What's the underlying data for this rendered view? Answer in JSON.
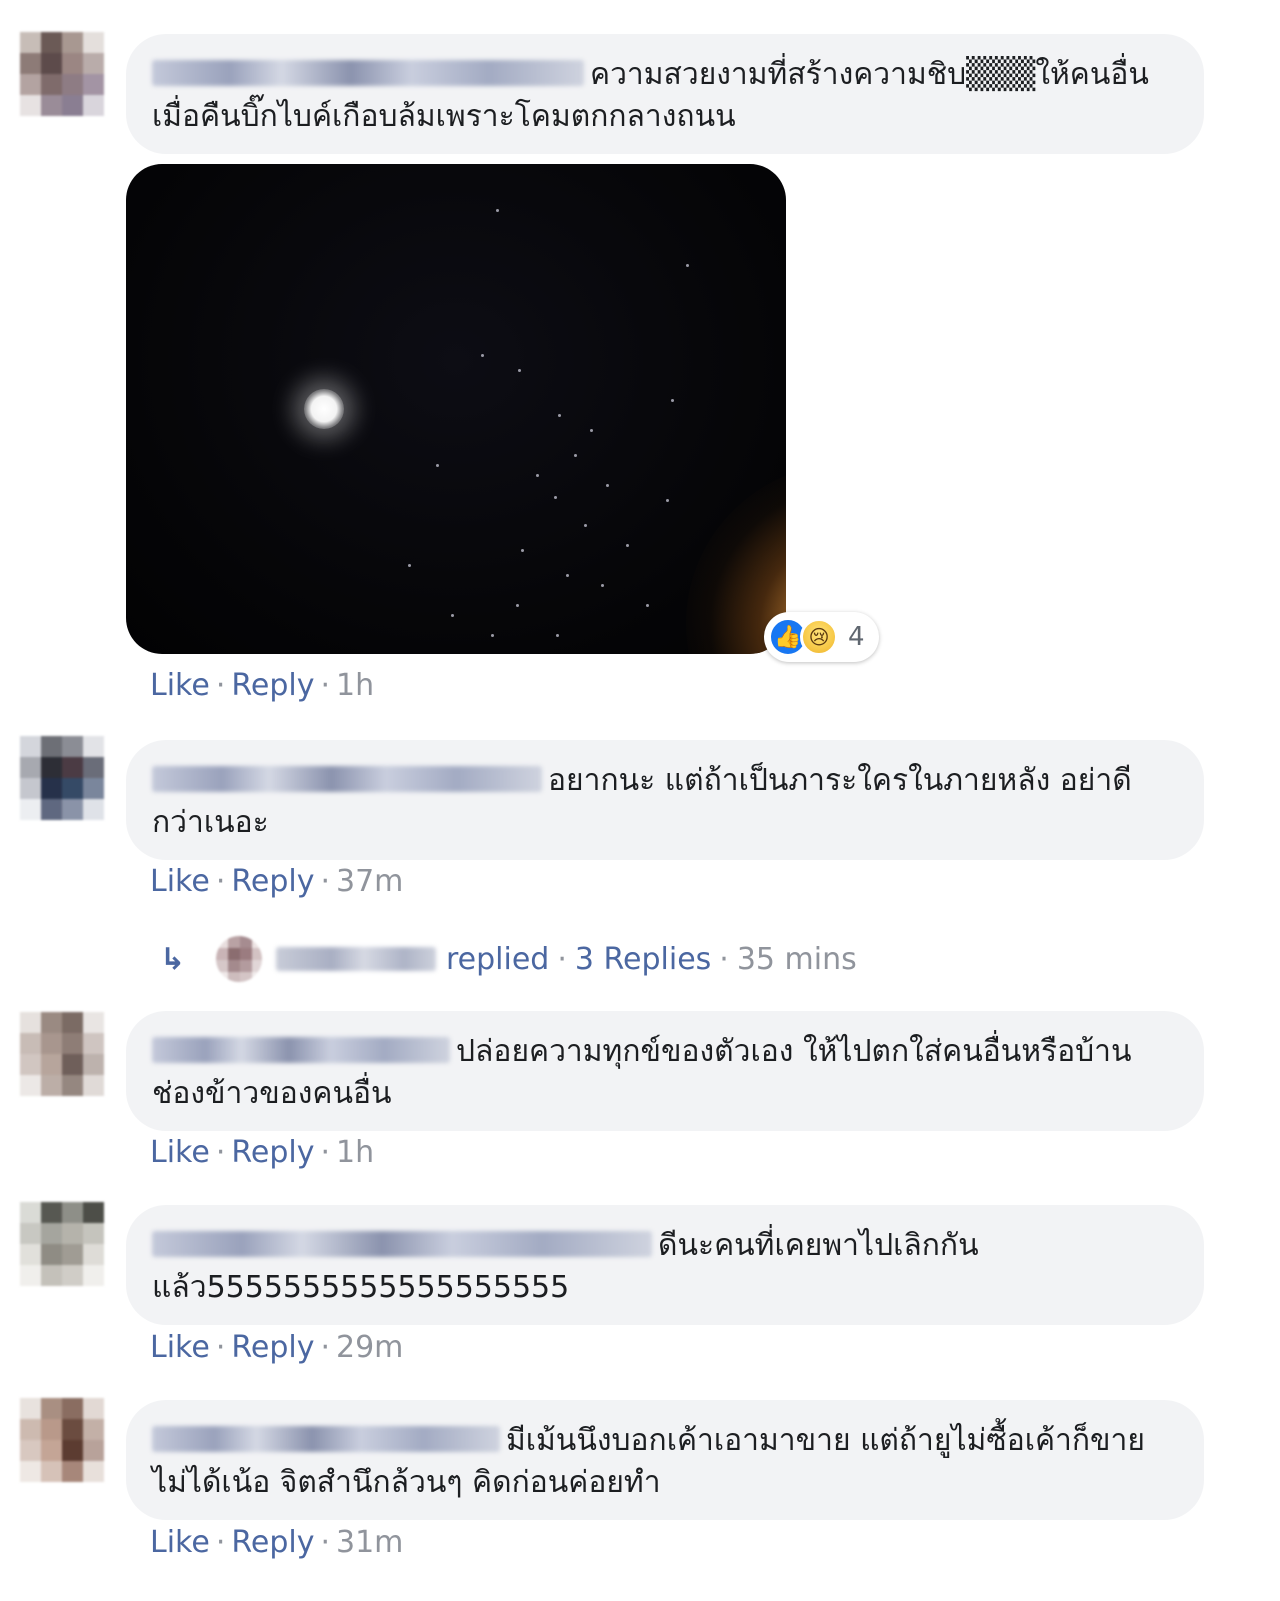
{
  "comments": [
    {
      "text": "ความสวยงามที่สร้างความชิบ▒▒▒ให้คนอื่น เมื่อคืนบิ๊กไบค์เกือบล้มเพราะโคมตกกลางถนน",
      "like": "Like",
      "reply": "Reply",
      "time": "1h",
      "reaction_count": "4"
    },
    {
      "text": "อยากนะ แต่ถ้าเป็นภาระใครในภายหลัง อย่าดีกว่าเนอะ",
      "like": "Like",
      "reply": "Reply",
      "time": "37m",
      "replies": {
        "replied": "replied",
        "count": "3 Replies",
        "time": "35 mins"
      }
    },
    {
      "text": "ปล่อยความทุกข์ของตัวเอง ให้ไปตกใส่คนอื่นหรือบ้านช่องข้าวของคนอื่น",
      "like": "Like",
      "reply": "Reply",
      "time": "1h"
    },
    {
      "text": "ดีนะคนที่เคยพาไปเลิกกันแล้ว5555555555555555555",
      "like": "Like",
      "reply": "Reply",
      "time": "29m"
    },
    {
      "text": "มีเม้นนึงบอกเค้าเอามาขาย แต่ถ้ายูไม่ซื้อเค้าก็ขายไม่ได้เน้อ จิตสำนึกล้วนๆ คิดก่อนค่อยทำ",
      "like": "Like",
      "reply": "Reply",
      "time": "31m"
    }
  ],
  "separator": "·",
  "icons": {
    "like_reaction": "thumbs-up-icon",
    "sad_reaction": "sad-face-icon",
    "reply_arrow": "reply-arrow-icon"
  },
  "colors": {
    "bubble": "#f2f3f5",
    "link": "#4b67a1",
    "meta": "#90949c",
    "like_blue": "#1877f2"
  }
}
